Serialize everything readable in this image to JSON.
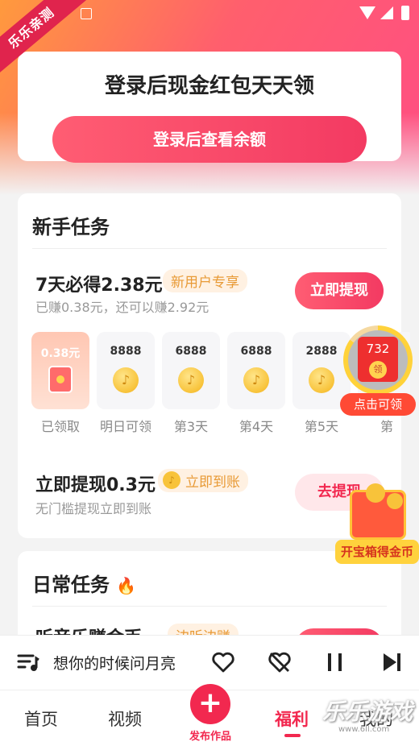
{
  "watermark_top": "乐乐亲测",
  "login_card": {
    "title": "登录后现金红包天天领",
    "button": "登录后查看余额"
  },
  "newbie": {
    "title": "新手任务",
    "task1": {
      "title": "7天必得2.38元",
      "tag": "新用户专享",
      "sub": "已赚0.38元，还可以赚2.92元",
      "button": "立即提现"
    },
    "days": [
      {
        "value": "0.38元",
        "label": "已领取"
      },
      {
        "value": "8888",
        "label": "明日可领"
      },
      {
        "value": "6888",
        "label": "第3天"
      },
      {
        "value": "6888",
        "label": "第4天"
      },
      {
        "value": "2888",
        "label": "第5天"
      },
      {
        "value": "",
        "label": "第"
      }
    ],
    "task2": {
      "title": "立即提现0.3元",
      "tag": "立即到账",
      "sub": "无门槛提现立即到账",
      "button": "去提现"
    }
  },
  "float_packet": {
    "amount": "732",
    "ling": "领",
    "label": "点击可领"
  },
  "treasure": {
    "label": "开宝箱得金币"
  },
  "daily": {
    "title": "日常任务",
    "task_partial": "听音乐赚金币",
    "tag_partial": "边听边赚"
  },
  "player": {
    "song": "想你的时候问月亮"
  },
  "tabs": {
    "home": "首页",
    "video": "视频",
    "publish": "发布作品",
    "welfare": "福利",
    "mine": "我的"
  },
  "watermark_bottom": {
    "text": "乐乐游戏",
    "url": "www.6ll.com"
  },
  "colors": {
    "accent": "#f2284f",
    "gold": "#f8c33a",
    "tag_text": "#e89a36"
  },
  "icons": {
    "playlist": "playlist-icon",
    "heart": "heart-icon",
    "dislike": "dislike-heart-icon",
    "pause": "pause-icon",
    "next": "next-icon",
    "fire": "fire-icon",
    "music_coin": "music-coin-icon"
  }
}
